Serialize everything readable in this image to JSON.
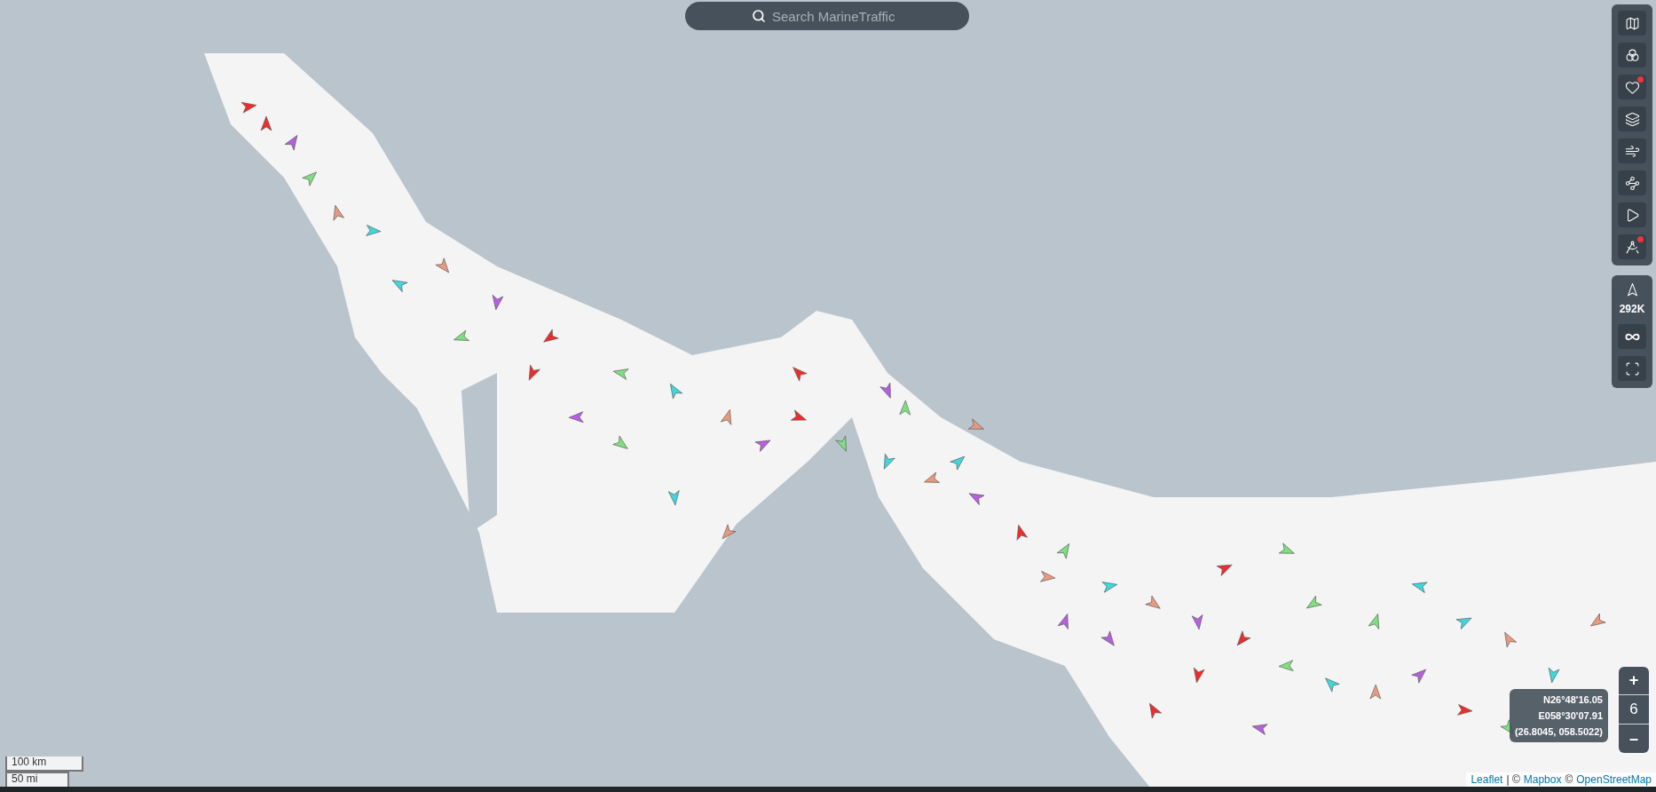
{
  "search": {
    "placeholder": "Search MarineTraffic"
  },
  "tools": [
    {
      "kind": "map",
      "locked": false
    },
    {
      "kind": "filters",
      "locked": false
    },
    {
      "kind": "favorites",
      "locked": true
    },
    {
      "kind": "layers",
      "locked": false
    },
    {
      "kind": "weather",
      "locked": false
    },
    {
      "kind": "density",
      "locked": false
    },
    {
      "kind": "playback",
      "locked": false
    },
    {
      "kind": "measure",
      "locked": true
    }
  ],
  "vessel_count": "292K",
  "zoom": {
    "zoom_in": "+",
    "level": "6",
    "zoom_out": "–"
  },
  "coordinates": [
    "N26°48'16.05",
    "E058°30'07.91",
    "(26.8045, 058.5022)"
  ],
  "scale": [
    "100 km",
    "50 mi"
  ],
  "attribution": [
    {
      "kind": "link",
      "text": "Leaflet"
    },
    {
      "kind": "text",
      "text": "| ©"
    },
    {
      "kind": "link",
      "text": "Mapbox"
    },
    {
      "kind": "text",
      "text": "©"
    },
    {
      "kind": "link",
      "text": "OpenStreetMap"
    }
  ]
}
